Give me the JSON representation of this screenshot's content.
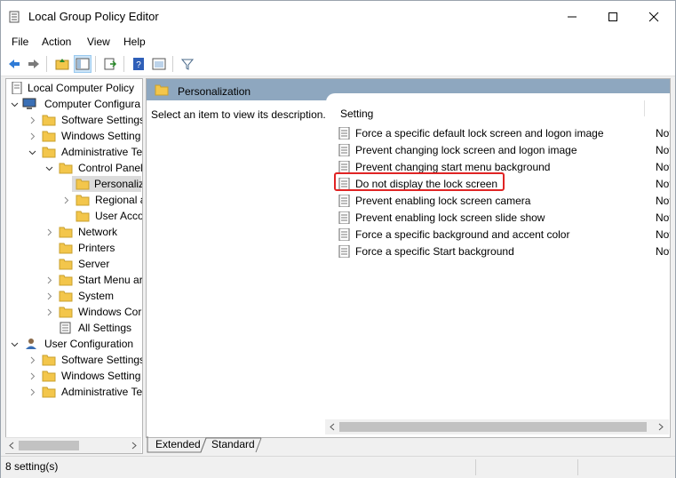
{
  "window": {
    "title": "Local Group Policy Editor"
  },
  "menu": [
    "File",
    "Action",
    "View",
    "Help"
  ],
  "tree": {
    "root": "Local Computer Policy",
    "computer_config": "Computer Configura",
    "cc_software": "Software Settings",
    "cc_windows": "Windows Setting",
    "admin_templates": "Administrative Te",
    "control_panel": "Control Panel",
    "personalization": "Personaliz",
    "regional": "Regional a",
    "user_accounts": "User Acco",
    "network": "Network",
    "printers": "Printers",
    "server": "Server",
    "start_menu": "Start Menu ar",
    "system": "System",
    "windows_comp": "Windows Cor",
    "all_settings": "All Settings",
    "user_config": "User Configuration",
    "uc_software": "Software Settings",
    "uc_windows": "Windows Setting",
    "uc_admin": "Administrative Te"
  },
  "right": {
    "header": "Personalization",
    "description": "Select an item to view its description.",
    "column": "Setting",
    "rows": [
      {
        "name": "Force a specific default lock screen and logon image",
        "state": "Not"
      },
      {
        "name": "Prevent changing lock screen and logon image",
        "state": "Not"
      },
      {
        "name": "Prevent changing start menu background",
        "state": "Not"
      },
      {
        "name": "Do not display the lock screen",
        "state": "Not"
      },
      {
        "name": "Prevent enabling lock screen camera",
        "state": "Not"
      },
      {
        "name": "Prevent enabling lock screen slide show",
        "state": "Not"
      },
      {
        "name": "Force a specific background and accent color",
        "state": "Not"
      },
      {
        "name": "Force a specific Start background",
        "state": "Not"
      }
    ]
  },
  "tabs": {
    "extended": "Extended",
    "standard": "Standard"
  },
  "status": {
    "text": "8 setting(s)"
  },
  "colors": {
    "highlight": "#e02424",
    "header": "#8ea7bf",
    "folder": "#f3c64b"
  }
}
